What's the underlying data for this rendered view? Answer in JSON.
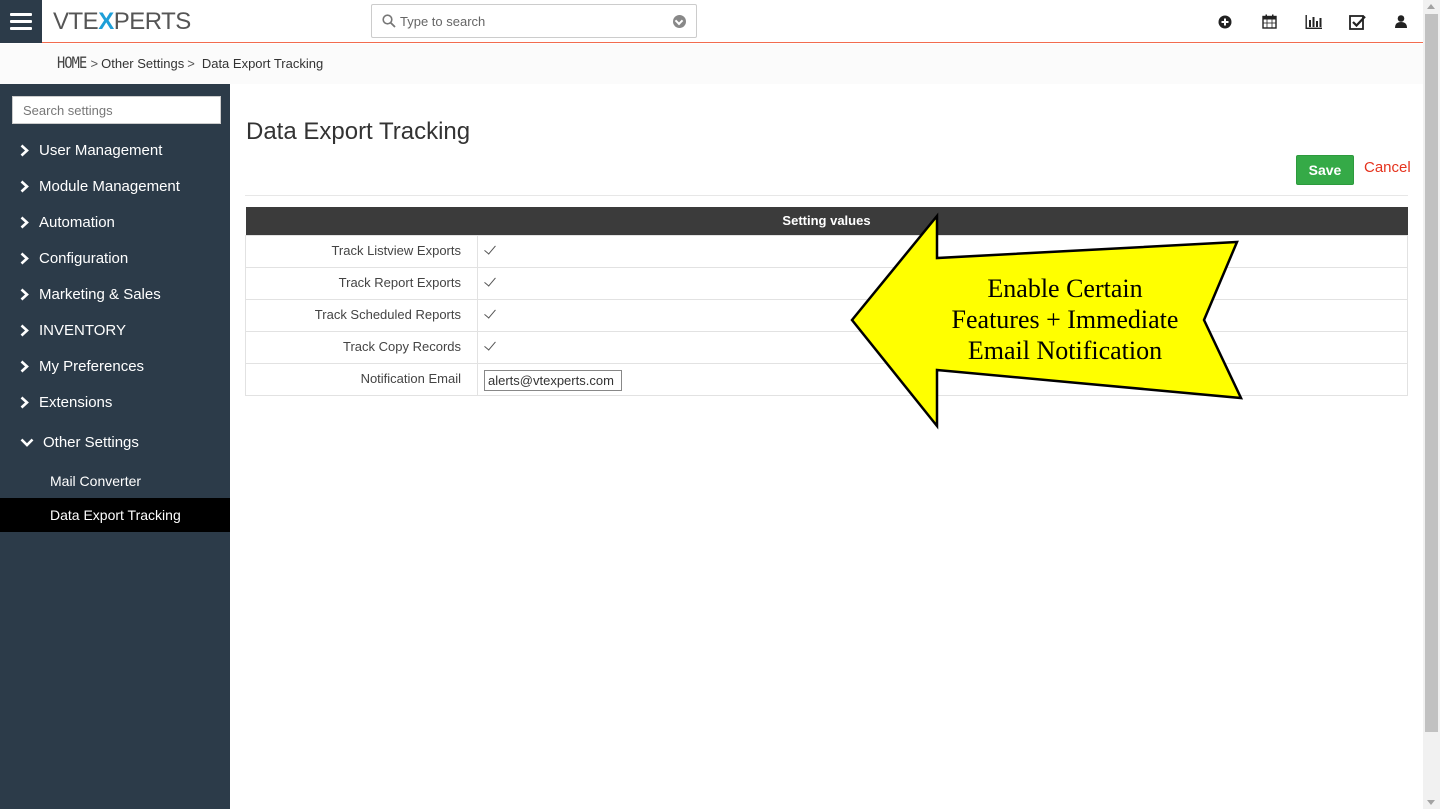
{
  "header": {
    "logo_pre": "VTE",
    "logo_x": "X",
    "logo_post": "PERTS",
    "search_placeholder": "Type to search",
    "icons": [
      "plus-circle-icon",
      "calendar-icon",
      "bar-chart-icon",
      "checkbox-icon",
      "user-icon"
    ]
  },
  "breadcrumb": {
    "home": "HOME",
    "sep": ">",
    "items": [
      "Other Settings",
      "Data Export Tracking"
    ]
  },
  "sidebar": {
    "search_placeholder": "Search settings",
    "items": [
      {
        "label": "User Management"
      },
      {
        "label": "Module Management"
      },
      {
        "label": "Automation"
      },
      {
        "label": "Configuration"
      },
      {
        "label": "Marketing & Sales"
      },
      {
        "label": "INVENTORY"
      },
      {
        "label": "My Preferences"
      },
      {
        "label": "Extensions"
      },
      {
        "label": "Other Settings"
      }
    ],
    "sub_items": [
      {
        "label": "Mail Converter"
      },
      {
        "label": "Data Export Tracking"
      }
    ]
  },
  "main": {
    "title": "Data Export Tracking",
    "save_label": "Save",
    "cancel_label": "Cancel",
    "table_header": "Setting values",
    "rows": [
      {
        "label": "Track Listview Exports",
        "checked": true
      },
      {
        "label": "Track Report Exports",
        "checked": true
      },
      {
        "label": "Track Scheduled Reports",
        "checked": true
      },
      {
        "label": "Track Copy Records",
        "checked": true
      }
    ],
    "email_label": "Notification Email",
    "email_value": "alerts@vtexperts.com"
  },
  "callout": {
    "line1": "Enable Certain",
    "line2": "Features + Immediate",
    "line3": "Email Notification",
    "fill": "#ffff00"
  },
  "colors": {
    "sidebar_bg": "#2c3b49",
    "accent_line": "#f26c4f",
    "save_green": "#35aa47",
    "cancel_red": "#e5331e"
  }
}
